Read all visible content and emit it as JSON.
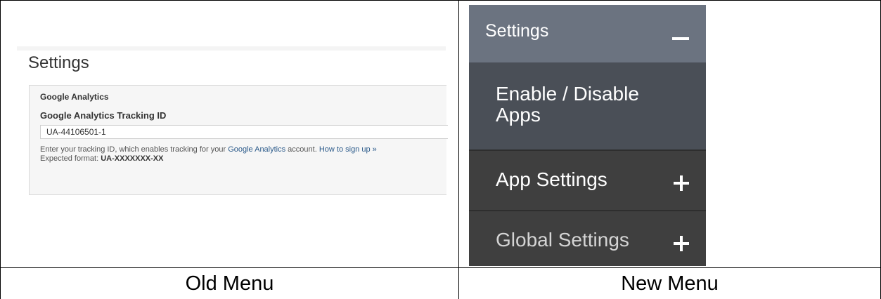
{
  "old_menu": {
    "title": "Settings",
    "section": "Google Analytics",
    "field_label": "Google Analytics Tracking ID",
    "field_value": "UA-44106501-1",
    "help_pre": "Enter your tracking ID, which enables tracking for your ",
    "help_link": "Google Analytics",
    "help_mid": " account. ",
    "help_signup": "How to sign up »",
    "format_pre": "Expected format: ",
    "format_value": "UA-XXXXXXX-XX"
  },
  "new_menu": {
    "header": "Settings",
    "enable_disable": "Enable / Disable Apps",
    "app_settings": "App Settings",
    "global_settings": "Global Settings"
  },
  "captions": {
    "old": "Old Menu",
    "new": "New Menu"
  },
  "colors": {
    "new_header_bg": "#6b7380",
    "new_active_bg": "#4a4f57",
    "new_item_bg": "#3f3f3f",
    "link": "#2b5a8a"
  }
}
